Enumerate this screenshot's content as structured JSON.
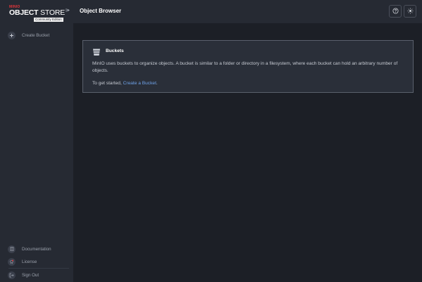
{
  "sidebar": {
    "logo": {
      "brand": "MINIO",
      "product_bold": "OBJECT",
      "product_light": " STORE",
      "edition": "Community Edition"
    },
    "create_bucket": "Create Bucket",
    "footer_items": {
      "documentation": "Documentation",
      "license": "License",
      "sign_out": "Sign Out"
    }
  },
  "header": {
    "title": "Object Browser"
  },
  "buckets_card": {
    "title": "Buckets",
    "description": "MinIO uses buckets to organize objects. A bucket is similar to a folder or directory in a filesystem, where each bucket can hold an arbitrary number of objects.",
    "cta_prefix": "To get started, ",
    "cta_link": "Create a Bucket",
    "cta_suffix": "."
  },
  "colors": {
    "brand_red": "#e3353a",
    "link_blue": "#6fa2e8",
    "background": "#1c1f26",
    "panel": "#262a33"
  },
  "icons": {
    "collapse": "collapse-sidebar-icon",
    "create": "plus-icon",
    "documentation": "document-icon",
    "license": "license-icon",
    "sign_out": "sign-out-icon",
    "help": "help-icon",
    "theme": "sun-icon",
    "bucket": "bucket-icon"
  }
}
